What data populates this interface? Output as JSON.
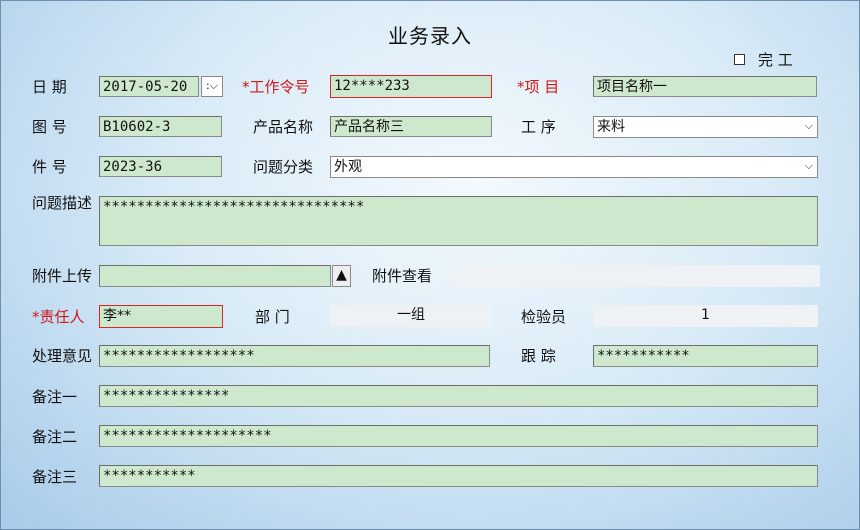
{
  "title": "业务录入",
  "complete": {
    "label": "完 工",
    "checked": false
  },
  "row1": {
    "date_label": "日  期",
    "date_value": "2017-05-20",
    "order_label": "*工作令号",
    "order_value": "12****233",
    "project_label": "*项  目",
    "project_value": "项目名称一"
  },
  "row2": {
    "drawing_label": "图  号",
    "drawing_value": "B10602-3",
    "product_label": "产品名称",
    "product_value": "产品名称三",
    "process_label": "工  序",
    "process_value": "来料"
  },
  "row3": {
    "piece_label": "件  号",
    "piece_value": "2023-36",
    "category_label": "问题分类",
    "category_value": "外观"
  },
  "row4": {
    "desc_label": "问题描述",
    "desc_value": "*******************************"
  },
  "row5": {
    "upload_label": "附件上传",
    "upload_value": "",
    "upload_btn": "▲",
    "view_label": "附件查看",
    "view_value": ""
  },
  "row6": {
    "owner_label": "*责任人",
    "owner_value": "李**",
    "dept_label": "部  门",
    "dept_value": "一组",
    "inspector_label": "检验员",
    "inspector_value": "1"
  },
  "row7": {
    "opinion_label": "处理意见",
    "opinion_value": "******************",
    "track_label": "跟  踪",
    "track_value": "***********"
  },
  "row8": {
    "note1_label": "备注一",
    "note1_value": "***************"
  },
  "row9": {
    "note2_label": "备注二",
    "note2_value": "********************"
  },
  "row10": {
    "note3_label": "备注三",
    "note3_value": "***********"
  },
  "icons": {
    "dropdown": "chevron-down-icon",
    "spinner": "spinner-icon",
    "upload": "triangle-up-icon"
  }
}
